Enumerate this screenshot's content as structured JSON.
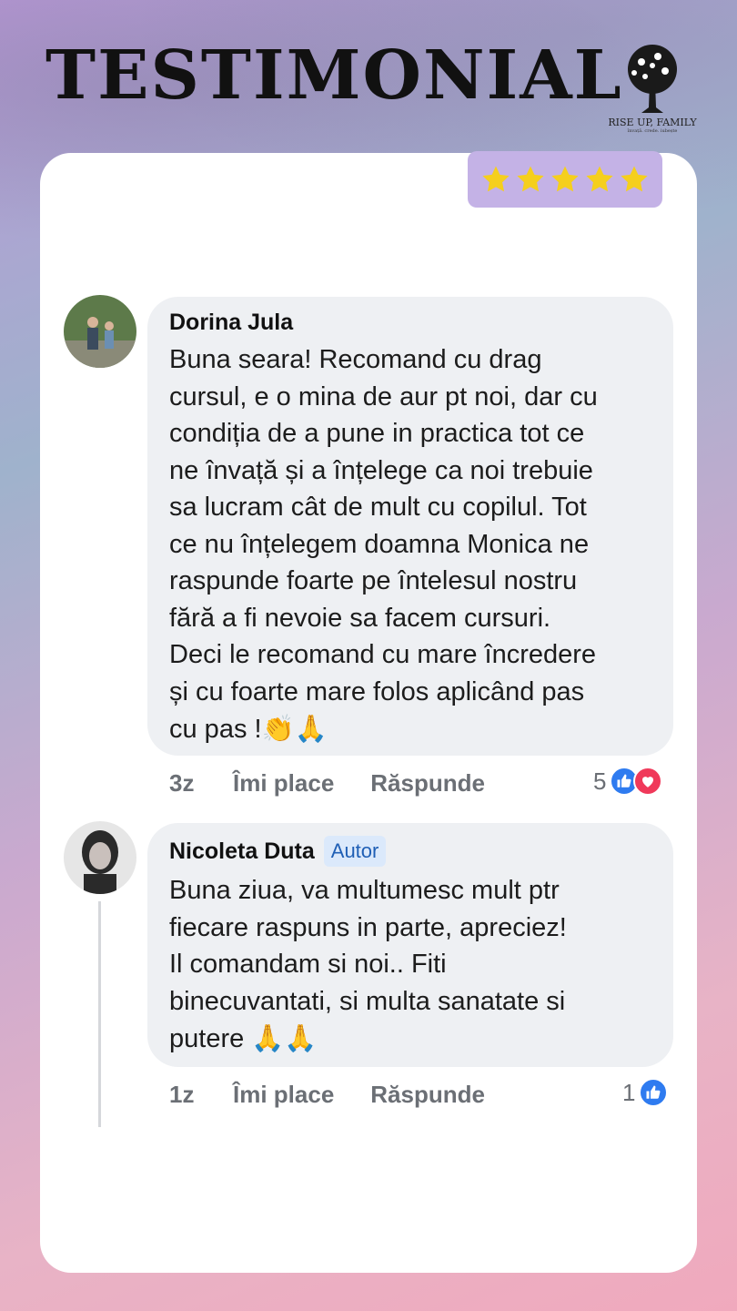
{
  "header": {
    "title": "TESTIMONIAL",
    "brand_name": "RISE UP, FAMILY",
    "brand_tagline": "învață. crede. iubește"
  },
  "rating": {
    "stars": 5,
    "max": 5,
    "star_color": "#f5cf1d"
  },
  "comments": [
    {
      "author": "Dorina Jula",
      "badge": "",
      "lines": [
        "Buna seara! Recomand cu drag",
        "cursul, e o mina de aur pt noi, dar cu",
        "condiția de a pune in practica tot ce",
        "ne învață și a înțelege ca noi trebuie",
        "sa lucram cât de mult cu copilul. Tot",
        "ce nu înțelegem doamna Monica ne",
        "raspunde foarte pe întelesul nostru",
        "fără a fi nevoie sa facem cursuri.",
        "Deci le recomand cu mare încredere",
        "și cu foarte mare folos aplicând pas",
        "cu pas !"
      ],
      "trailing_emoji": "👏🙏",
      "time": "3z",
      "like_label": "Îmi place",
      "reply_label": "Răspunde",
      "reaction_count": "5"
    },
    {
      "author": "Nicoleta Duta",
      "badge": "Autor",
      "lines": [
        "Buna ziua, va multumesc mult ptr",
        "fiecare raspuns in parte, apreciez!",
        "Il comandam si noi.. Fiti",
        "binecuvantati, si multa sanatate si",
        "putere "
      ],
      "trailing_emoji": "🙏🙏",
      "time": "1z",
      "like_label": "Îmi place",
      "reply_label": "Răspunde",
      "reaction_count": "1"
    }
  ]
}
